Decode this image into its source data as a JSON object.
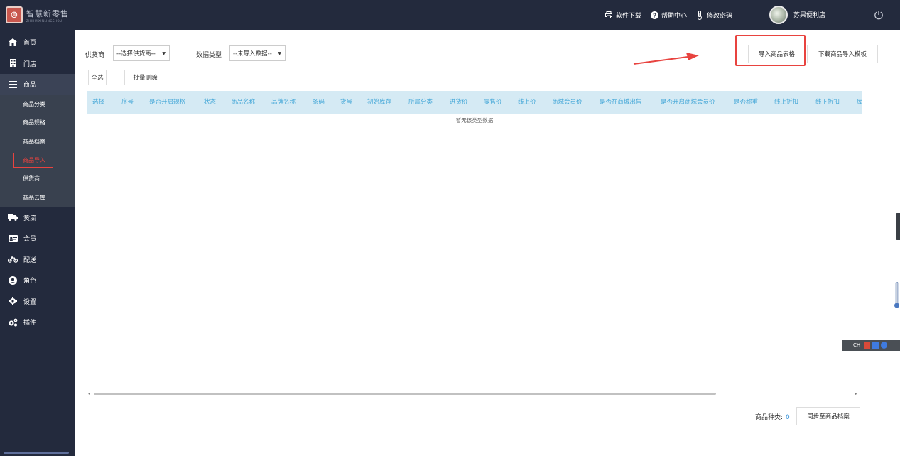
{
  "header": {
    "logo_text": "智慧新零售",
    "logo_subtext": "ZHIHUIXINLINGSHOU",
    "links": [
      {
        "icon": "printer-icon",
        "label": "软件下载"
      },
      {
        "icon": "help-circle-icon",
        "label": "帮助中心"
      },
      {
        "icon": "thermometer-icon",
        "label": "修改密码"
      }
    ],
    "store_name": "苏果便利店"
  },
  "sidebar": {
    "items": [
      {
        "icon": "home-icon",
        "label": "首页"
      },
      {
        "icon": "store-icon",
        "label": "门店"
      },
      {
        "icon": "menu-icon",
        "label": "商品"
      }
    ],
    "sub_items": [
      {
        "label": "商品分类"
      },
      {
        "label": "商品规格"
      },
      {
        "label": "商品档案"
      },
      {
        "label": "商品导入"
      },
      {
        "label": "供货商"
      },
      {
        "label": "商品云库"
      }
    ],
    "items_after": [
      {
        "icon": "truck-icon",
        "label": "货流"
      },
      {
        "icon": "id-card-icon",
        "label": "会员"
      },
      {
        "icon": "motorcycle-icon",
        "label": "配送"
      },
      {
        "icon": "user-circle-icon",
        "label": "角色"
      },
      {
        "icon": "gear-icon",
        "label": "设置"
      },
      {
        "icon": "gears-icon",
        "label": "插件"
      }
    ]
  },
  "filters": {
    "supplier_label": "供货商",
    "supplier_value": "--选择供货商--",
    "datatype_label": "数据类型",
    "datatype_value": "--未导入数据--"
  },
  "actions": {
    "import_label": "导入商品表格",
    "download_template_label": "下载商品导入模板",
    "select_all_label": "全选",
    "batch_delete_label": "批量删除"
  },
  "table": {
    "columns": [
      "选择",
      "序号",
      "是否开启规格",
      "状态",
      "商品名称",
      "品牌名称",
      "条码",
      "货号",
      "初始库存",
      "所属分类",
      "进货价",
      "零售价",
      "线上价",
      "商城会员价",
      "是否在商城出售",
      "是否开启商城会员价",
      "是否称重",
      "线上折扣",
      "线下折扣",
      "库"
    ],
    "empty_text": "暂无该类型数据"
  },
  "footer": {
    "count_label": "商品种类:",
    "count_value": "0",
    "sync_label": "同步至商品档案"
  },
  "ime_bar": {
    "label": "CH"
  },
  "colors": {
    "topbar": "#232a3d",
    "header_cell_text": "#46a8d8",
    "header_bg": "#d5eaf4",
    "highlight_red": "#e8433f"
  }
}
